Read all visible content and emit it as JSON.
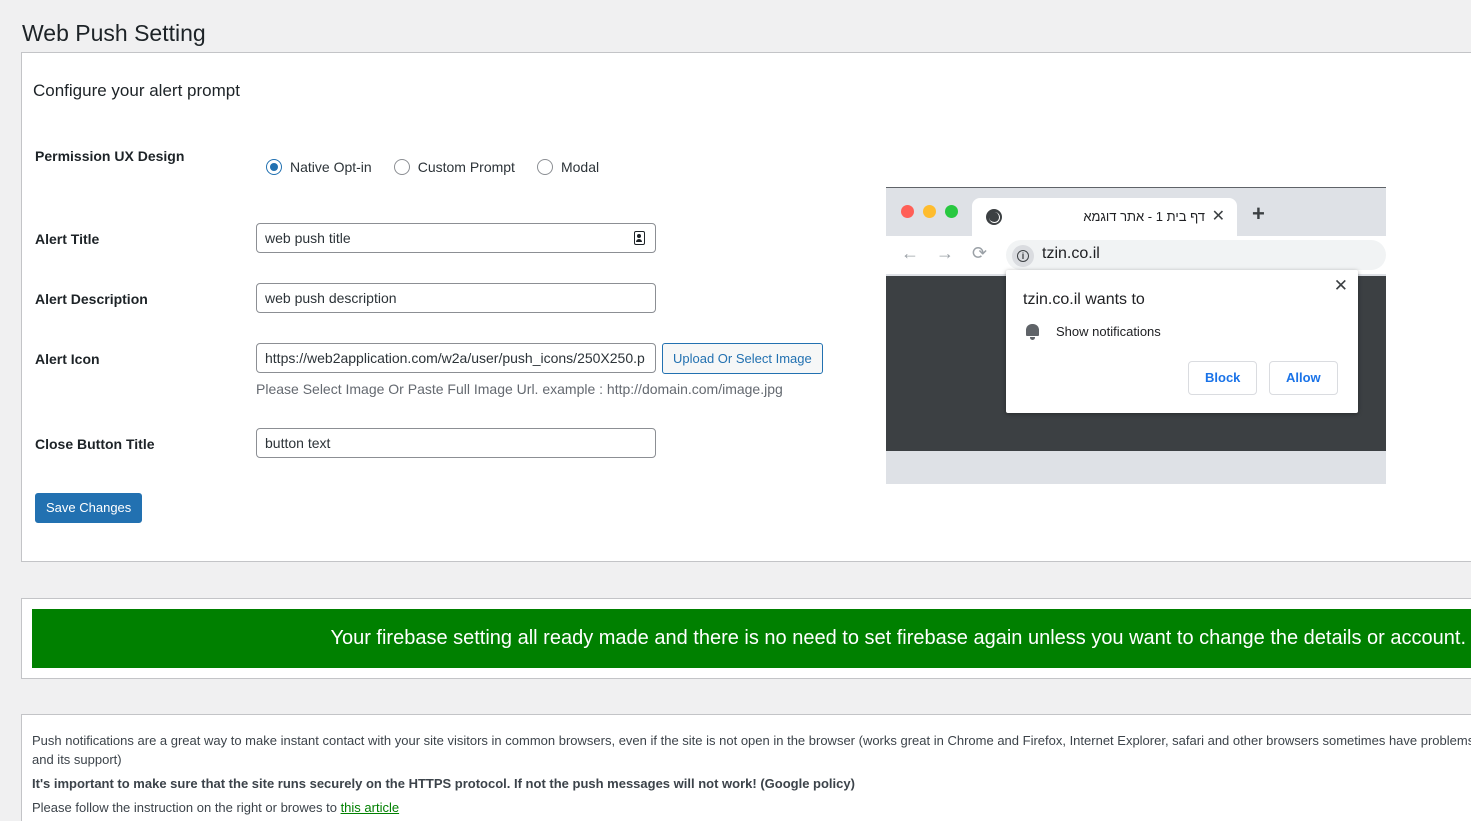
{
  "page": {
    "title": "Web Push Setting"
  },
  "form": {
    "heading": "Configure your alert prompt",
    "permission": {
      "label": "Permission UX Design",
      "options": [
        "Native Opt-in",
        "Custom Prompt",
        "Modal"
      ],
      "selected": "Native Opt-in"
    },
    "alert_title": {
      "label": "Alert Title",
      "value": "web push title"
    },
    "alert_description": {
      "label": "Alert Description",
      "value": "web push description"
    },
    "alert_icon": {
      "label": "Alert Icon",
      "value": "https://web2application.com/w2a/user/push_icons/250X250.p",
      "upload_label": "Upload Or Select Image",
      "help": "Please Select Image Or Paste Full Image Url. example : http://domain.com/image.jpg"
    },
    "close_button": {
      "label": "Close Button Title",
      "value": "button text"
    },
    "save_label": "Save Changes"
  },
  "preview": {
    "tab_title": "דף בית 1 - אתר דוגמא",
    "tab_close": "✕",
    "new_tab": "+",
    "url": "tzin.co.il",
    "popup_title": "tzin.co.il wants to",
    "popup_permission": "Show notifications",
    "popup_close": "✕",
    "block_label": "Block",
    "allow_label": "Allow",
    "icons": {
      "back": "←",
      "forward": "→",
      "reload": "⟳",
      "info": "i"
    }
  },
  "notice": {
    "text": "Your firebase setting all ready made and there is no need to set firebase again unless you want to change the details or account.",
    "color": "#008000"
  },
  "info": {
    "p1_line1": "Push notifications are a great way to make instant contact with your site visitors in common browsers, even if the site is not open in the browser (works great in Chrome and Firefox, Internet Explorer, safari and other browsers sometimes have problems c",
    "p1_line2": "and its support)",
    "p2": "It's important to make sure that the site runs securely on the HTTPS protocol. If not the push messages will not work! (Google policy)",
    "p3_prefix": "Please follow the instruction on the right or browes to ",
    "p3_link": "this article"
  },
  "colors": {
    "accent": "#2271b1",
    "green": "#008000"
  }
}
